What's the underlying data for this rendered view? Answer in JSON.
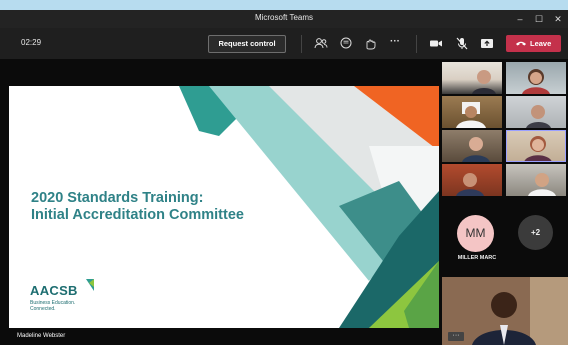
{
  "window": {
    "title": "Microsoft Teams",
    "minimize": "–",
    "maximize": "☐",
    "close": "✕"
  },
  "toolbar": {
    "timer": "02:29",
    "request_control": "Request control",
    "more": "···",
    "leave": "Leave"
  },
  "slide": {
    "title_line1": "2020 Standards Training:",
    "title_line2": "Initial Accreditation Committee",
    "logo_word": "AACSB",
    "logo_tag1": "Business Education.",
    "logo_tag2": "Connected."
  },
  "presenter": "Madeline Webster",
  "participants": {
    "avatar_initials": "MM",
    "avatar_name": "MILLER MARC",
    "overflow": "+2",
    "spotlight_more": "···"
  },
  "colors": {
    "leave": "#c4314b",
    "teal": "#2f8287",
    "orange": "#f06423",
    "green": "#8dc63f"
  }
}
